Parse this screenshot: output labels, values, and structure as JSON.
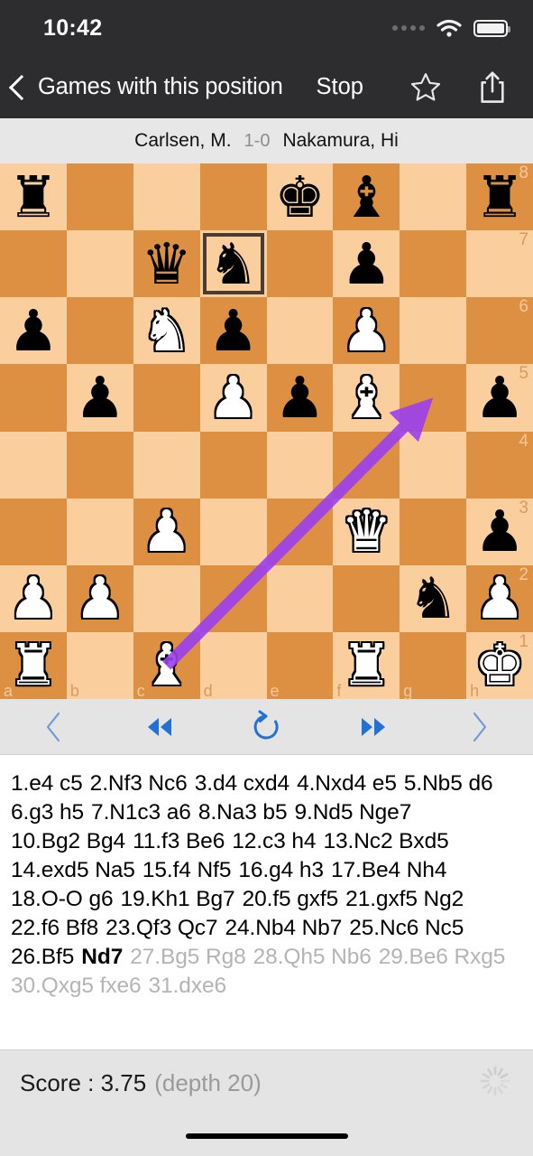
{
  "status_bar": {
    "time": "10:42",
    "signal_icon": "signal-dots-icon",
    "wifi_icon": "wifi-icon",
    "battery_icon": "battery-full-icon"
  },
  "nav_bar": {
    "back_label": "Games with this position",
    "back_icon": "chevron-left-icon",
    "stop_label": "Stop",
    "star_icon": "star-outline-icon",
    "share_icon": "share-upload-icon"
  },
  "game_header": {
    "white_player": "Carlsen, M.",
    "result": "1-0",
    "black_player": "Nakamura, Hi"
  },
  "board": {
    "light_square_color": "#fbce9d",
    "dark_square_color": "#dd9042",
    "highlight_border_color": "#4b3b30",
    "arrow_color": "#9b3ff0",
    "files": [
      "a",
      "b",
      "c",
      "d",
      "e",
      "f",
      "g",
      "h"
    ],
    "ranks": [
      "8",
      "7",
      "6",
      "5",
      "4",
      "3",
      "2",
      "1"
    ],
    "highlighted_square": "d7",
    "arrow": {
      "from": "c1",
      "to": "g5"
    },
    "position_rows": [
      [
        "r",
        "",
        "",
        "",
        "k",
        "b",
        "",
        "r"
      ],
      [
        "",
        "",
        "q",
        "n",
        "",
        "p",
        "",
        ""
      ],
      [
        "p",
        "",
        "N",
        "p",
        "",
        "P",
        "",
        ""
      ],
      [
        "",
        "p",
        "",
        "P",
        "p",
        "B",
        "",
        "p"
      ],
      [
        "",
        "",
        "",
        "",
        "",
        "",
        "",
        ""
      ],
      [
        "",
        "",
        "P",
        "",
        "",
        "Q",
        "",
        "p"
      ],
      [
        "P",
        "P",
        "",
        "",
        "",
        "",
        "n",
        "P"
      ],
      [
        "R",
        "",
        "B",
        "",
        "",
        "R",
        "",
        "K"
      ]
    ]
  },
  "move_nav": {
    "prev_icon": "chevron-left-thin-icon",
    "rewind_icon": "rewind-double-icon",
    "reset_icon": "refresh-counterclockwise-icon",
    "forward_icon": "fast-forward-double-icon",
    "next_icon": "chevron-right-thin-icon",
    "accent_color": "#2272d6",
    "muted_accent_color": "#6e9bd8"
  },
  "moves": {
    "played": [
      "1.e4 c5",
      "2.Nf3 Nc6",
      "3.d4 cxd4",
      "4.Nxd4 e5",
      "5.Nb5 d6",
      "6.g3 h5",
      "7.N1c3 a6",
      "8.Na3 b5",
      "9.Nd5 Nge7",
      "10.Bg2 Bg4",
      "11.f3 Be6",
      "12.c3 h4",
      "13.Nc2 Bxd5",
      "14.exd5 Na5",
      "15.f4 Nf5",
      "16.g4 h3",
      "17.Be4 Nh4",
      "18.O-O g6",
      "19.Kh1 Bg7",
      "20.f5 gxf5",
      "21.gxf5 Ng2",
      "22.f6 Bf8",
      "23.Qf3 Qc7",
      "24.Nb4 Nb7",
      "25.Nc6 Nc5",
      "26.Bf5"
    ],
    "current": "Nd7",
    "future": [
      "27.Bg5 Rg8",
      "28.Qh5 Nb6",
      "29.Be6 Rxg5",
      "30.Qxg5 fxe6",
      "31.dxe6"
    ]
  },
  "engine": {
    "score_label": "Score : 3.75",
    "depth_label": "(depth 20)",
    "spinner_icon": "loading-spinner-icon"
  }
}
